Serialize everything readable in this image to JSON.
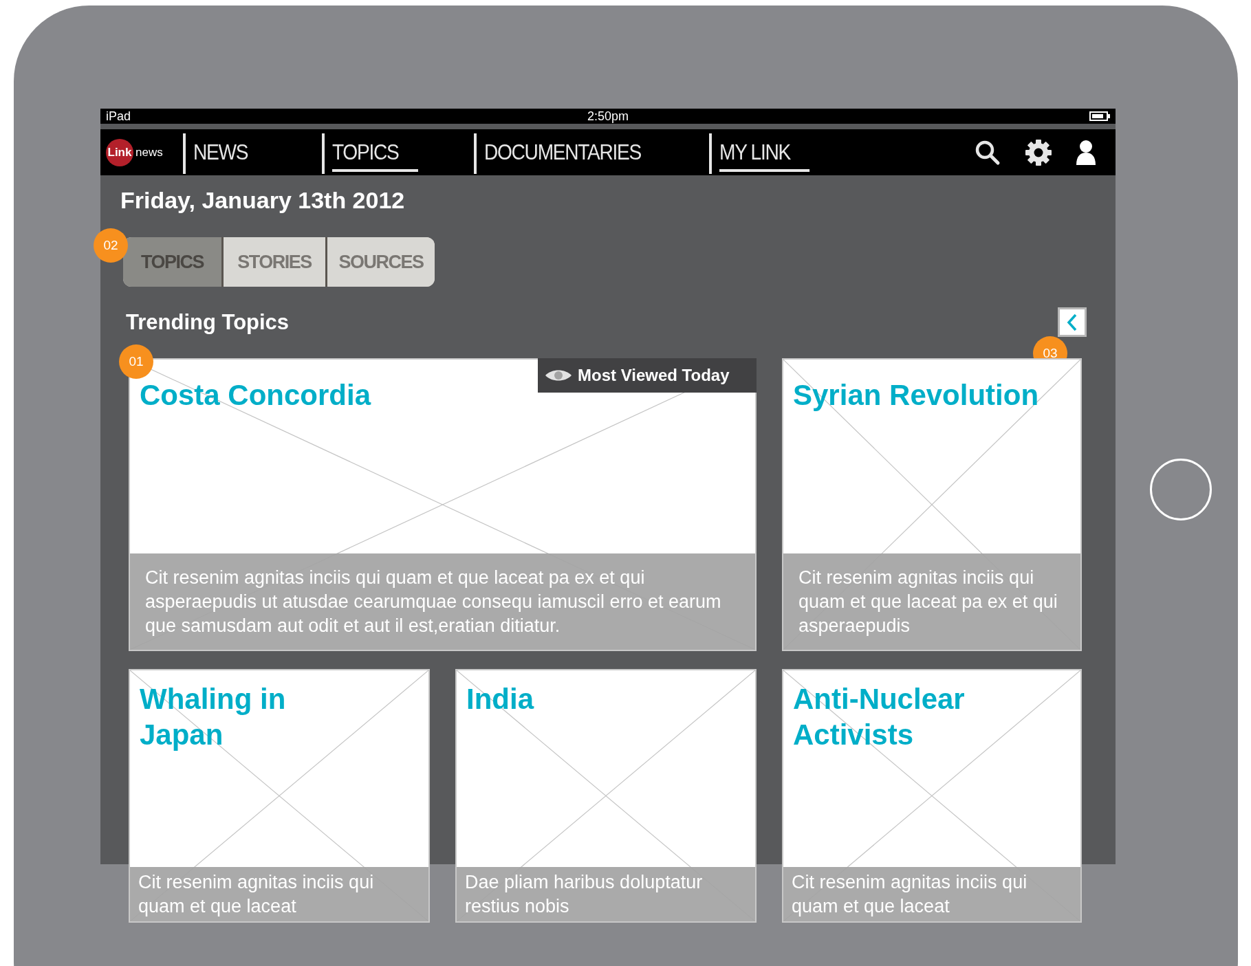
{
  "status_bar": {
    "device": "iPad",
    "time": "2:50pm"
  },
  "nav": {
    "logo": {
      "mark": "Link",
      "text": "news"
    },
    "items": [
      {
        "label": "NEWS",
        "underlined": false
      },
      {
        "label": "TOPICS",
        "underlined": true
      },
      {
        "label": "DOCUMENTARIES",
        "underlined": false
      },
      {
        "label": "MY LINK",
        "underlined": true
      }
    ]
  },
  "date": "Friday, January 13th 2012",
  "view_tabs": {
    "badge": "02",
    "tabs": [
      {
        "label": "TOPICS",
        "selected": true
      },
      {
        "label": "STORIES",
        "selected": false
      },
      {
        "label": "SOURCES",
        "selected": false
      }
    ]
  },
  "back_badge": "03",
  "section_title": "Trending Topics",
  "cards": [
    {
      "title": "Costa Concordia",
      "text": "Cit resenim agnitas inciis qui quam et que laceat pa ex et qui asperaepudis ut atusdae cearumquae consequ iamuscil erro et earum que samusdam aut odit et aut il est,eratian ditiatur.",
      "badge": "01",
      "tag": "Most Viewed Today",
      "wide": true
    },
    {
      "title": "Syrian Revolution",
      "text": "Cit resenim agnitas inciis qui quam et que laceat pa ex et qui asperaepudis",
      "wide": false
    },
    {
      "title": "Whaling in Japan",
      "text": "Cit resenim agnitas inciis qui quam et que laceat",
      "wide": false
    },
    {
      "title": "India",
      "text": "Dae pliam haribus doluptatur restius nobis",
      "wide": false
    },
    {
      "title": "Anti-Nuclear Activists",
      "text": "Cit resenim agnitas inciis qui quam et que laceat",
      "wide": false
    }
  ]
}
